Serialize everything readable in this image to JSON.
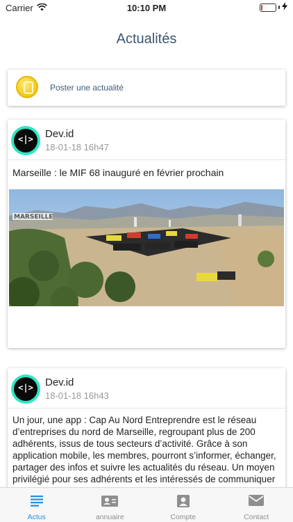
{
  "status": {
    "carrier": "Carrier",
    "time": "10:10 PM",
    "battery_level": 0.1,
    "battery_color": "#e0302a"
  },
  "page": {
    "title": "Actualités"
  },
  "composer": {
    "label": "Poster une actualité",
    "icon": "coin-logo-icon"
  },
  "posts": [
    {
      "author": "Dev.id",
      "date": "18-01-18 16h47",
      "avatar_glyph": "<|>",
      "title": "Marseille : le MIF 68 inauguré en février prochain",
      "image": "photo-marseille-containers"
    },
    {
      "author": "Dev.id",
      "date": "18-01-18 16h43",
      "avatar_glyph": "<|>",
      "body": "Un jour, une app : Cap Au Nord Entreprendre est le réseau d’entreprises du nord de Marseille, regroupant plus de 200 adhérents, issus de tous secteurs d’activité.  Grâce à son application mobile, les membres, pourront s’informer, échanger, partager des infos et suivre les actualités du réseau. Un moyen privilégié pour ses adhérents et les intéressés de communiquer directement et autrement. Disponible très"
    }
  ],
  "tabs": [
    {
      "label": "Actus",
      "icon": "news-list-icon",
      "active": true
    },
    {
      "label": "annuaire",
      "icon": "contact-card-icon",
      "active": false
    },
    {
      "label": "Compte",
      "icon": "account-icon",
      "active": false
    },
    {
      "label": "Contact",
      "icon": "mail-icon",
      "active": false
    }
  ],
  "colors": {
    "accent": "#1f8fe5",
    "title": "#3b5570",
    "inactive": "#8e8e8e"
  }
}
